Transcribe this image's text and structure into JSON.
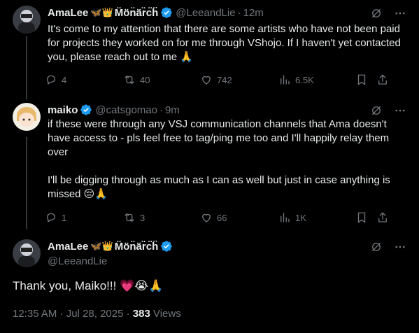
{
  "colors": {
    "background": "#000000",
    "text": "#e7e9ea",
    "muted": "#71767b",
    "verified": "#1d9bf0"
  },
  "tweets": [
    {
      "name": "AmaLee",
      "name_emoji": "🦋👑",
      "name_suffix": "M̈ö̈n̈ä̈r̈c̈ḧ",
      "handle": "@LeeandLie",
      "separator": "·",
      "time": "12m",
      "text": "It's come to my attention that there are some artists who have not been paid for projects they worked on for me through VShojo. If I haven't yet contacted you, please reach out to me 🙏",
      "replies": "4",
      "reposts": "40",
      "likes": "742",
      "views": "6.5K"
    },
    {
      "name": "maiko",
      "handle": "@catsgomao",
      "separator": "·",
      "time": "9m",
      "text_p1": "if these were through any VSJ communication channels that Ama doesn't have access to - pls feel free to tag/ping me too and I'll happily relay them over",
      "text_p2": "I'll be digging through as much as I can as well but just in case anything is missed 😔🙏",
      "replies": "1",
      "reposts": "3",
      "likes": "66",
      "views": "1K"
    }
  ],
  "main": {
    "name": "AmaLee",
    "name_emoji": "🦋👑",
    "name_suffix": "M̈ö̈n̈ä̈r̈c̈ḧ",
    "handle": "@LeeandLie",
    "text": "Thank you, Maiko!!! 💗😭🙏",
    "timestamp": "12:35 AM · Jul 28, 2025 · ",
    "views_count": "383",
    "views_label": " Views"
  },
  "icons": [
    "grok-icon",
    "more-icon",
    "reply-icon",
    "repost-icon",
    "like-icon",
    "views-icon",
    "bookmark-icon",
    "share-icon",
    "verified-icon"
  ]
}
